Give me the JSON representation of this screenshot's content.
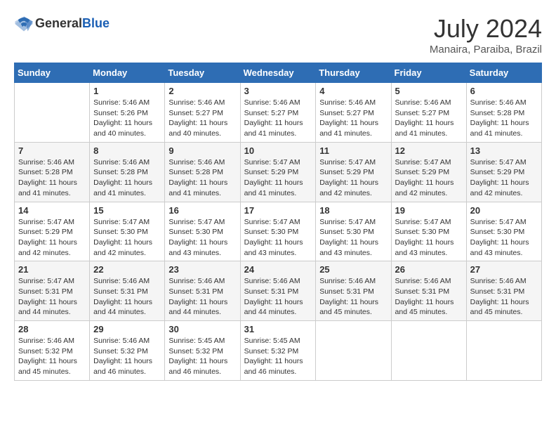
{
  "header": {
    "logo_general": "General",
    "logo_blue": "Blue",
    "month_title": "July 2024",
    "location": "Manaira, Paraiba, Brazil"
  },
  "days_of_week": [
    "Sunday",
    "Monday",
    "Tuesday",
    "Wednesday",
    "Thursday",
    "Friday",
    "Saturday"
  ],
  "weeks": [
    [
      {
        "day": "",
        "info": ""
      },
      {
        "day": "1",
        "info": "Sunrise: 5:46 AM\nSunset: 5:26 PM\nDaylight: 11 hours\nand 40 minutes."
      },
      {
        "day": "2",
        "info": "Sunrise: 5:46 AM\nSunset: 5:27 PM\nDaylight: 11 hours\nand 40 minutes."
      },
      {
        "day": "3",
        "info": "Sunrise: 5:46 AM\nSunset: 5:27 PM\nDaylight: 11 hours\nand 41 minutes."
      },
      {
        "day": "4",
        "info": "Sunrise: 5:46 AM\nSunset: 5:27 PM\nDaylight: 11 hours\nand 41 minutes."
      },
      {
        "day": "5",
        "info": "Sunrise: 5:46 AM\nSunset: 5:27 PM\nDaylight: 11 hours\nand 41 minutes."
      },
      {
        "day": "6",
        "info": "Sunrise: 5:46 AM\nSunset: 5:28 PM\nDaylight: 11 hours\nand 41 minutes."
      }
    ],
    [
      {
        "day": "7",
        "info": "Sunrise: 5:46 AM\nSunset: 5:28 PM\nDaylight: 11 hours\nand 41 minutes."
      },
      {
        "day": "8",
        "info": "Sunrise: 5:46 AM\nSunset: 5:28 PM\nDaylight: 11 hours\nand 41 minutes."
      },
      {
        "day": "9",
        "info": "Sunrise: 5:46 AM\nSunset: 5:28 PM\nDaylight: 11 hours\nand 41 minutes."
      },
      {
        "day": "10",
        "info": "Sunrise: 5:47 AM\nSunset: 5:29 PM\nDaylight: 11 hours\nand 41 minutes."
      },
      {
        "day": "11",
        "info": "Sunrise: 5:47 AM\nSunset: 5:29 PM\nDaylight: 11 hours\nand 42 minutes."
      },
      {
        "day": "12",
        "info": "Sunrise: 5:47 AM\nSunset: 5:29 PM\nDaylight: 11 hours\nand 42 minutes."
      },
      {
        "day": "13",
        "info": "Sunrise: 5:47 AM\nSunset: 5:29 PM\nDaylight: 11 hours\nand 42 minutes."
      }
    ],
    [
      {
        "day": "14",
        "info": "Sunrise: 5:47 AM\nSunset: 5:29 PM\nDaylight: 11 hours\nand 42 minutes."
      },
      {
        "day": "15",
        "info": "Sunrise: 5:47 AM\nSunset: 5:30 PM\nDaylight: 11 hours\nand 42 minutes."
      },
      {
        "day": "16",
        "info": "Sunrise: 5:47 AM\nSunset: 5:30 PM\nDaylight: 11 hours\nand 43 minutes."
      },
      {
        "day": "17",
        "info": "Sunrise: 5:47 AM\nSunset: 5:30 PM\nDaylight: 11 hours\nand 43 minutes."
      },
      {
        "day": "18",
        "info": "Sunrise: 5:47 AM\nSunset: 5:30 PM\nDaylight: 11 hours\nand 43 minutes."
      },
      {
        "day": "19",
        "info": "Sunrise: 5:47 AM\nSunset: 5:30 PM\nDaylight: 11 hours\nand 43 minutes."
      },
      {
        "day": "20",
        "info": "Sunrise: 5:47 AM\nSunset: 5:30 PM\nDaylight: 11 hours\nand 43 minutes."
      }
    ],
    [
      {
        "day": "21",
        "info": "Sunrise: 5:47 AM\nSunset: 5:31 PM\nDaylight: 11 hours\nand 44 minutes."
      },
      {
        "day": "22",
        "info": "Sunrise: 5:46 AM\nSunset: 5:31 PM\nDaylight: 11 hours\nand 44 minutes."
      },
      {
        "day": "23",
        "info": "Sunrise: 5:46 AM\nSunset: 5:31 PM\nDaylight: 11 hours\nand 44 minutes."
      },
      {
        "day": "24",
        "info": "Sunrise: 5:46 AM\nSunset: 5:31 PM\nDaylight: 11 hours\nand 44 minutes."
      },
      {
        "day": "25",
        "info": "Sunrise: 5:46 AM\nSunset: 5:31 PM\nDaylight: 11 hours\nand 45 minutes."
      },
      {
        "day": "26",
        "info": "Sunrise: 5:46 AM\nSunset: 5:31 PM\nDaylight: 11 hours\nand 45 minutes."
      },
      {
        "day": "27",
        "info": "Sunrise: 5:46 AM\nSunset: 5:31 PM\nDaylight: 11 hours\nand 45 minutes."
      }
    ],
    [
      {
        "day": "28",
        "info": "Sunrise: 5:46 AM\nSunset: 5:32 PM\nDaylight: 11 hours\nand 45 minutes."
      },
      {
        "day": "29",
        "info": "Sunrise: 5:46 AM\nSunset: 5:32 PM\nDaylight: 11 hours\nand 46 minutes."
      },
      {
        "day": "30",
        "info": "Sunrise: 5:45 AM\nSunset: 5:32 PM\nDaylight: 11 hours\nand 46 minutes."
      },
      {
        "day": "31",
        "info": "Sunrise: 5:45 AM\nSunset: 5:32 PM\nDaylight: 11 hours\nand 46 minutes."
      },
      {
        "day": "",
        "info": ""
      },
      {
        "day": "",
        "info": ""
      },
      {
        "day": "",
        "info": ""
      }
    ]
  ]
}
